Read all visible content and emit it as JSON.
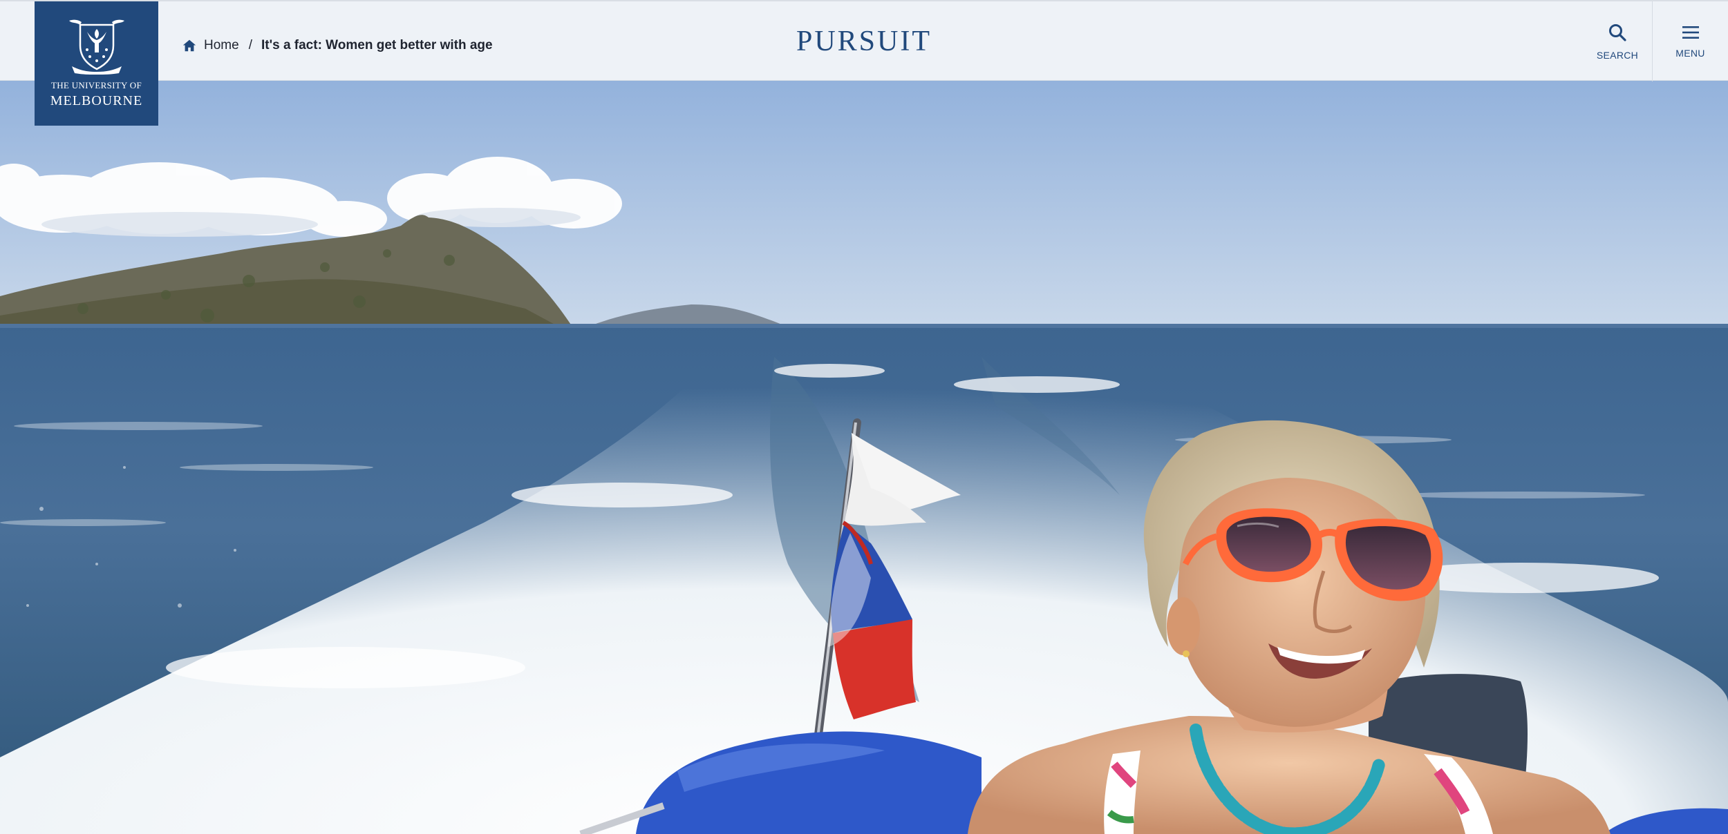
{
  "header": {
    "logo": {
      "line1": "THE UNIVERSITY OF",
      "line2": "MELBOURNE",
      "icon": "university-crest-icon"
    },
    "breadcrumb": {
      "home_label": "Home",
      "separator": "/",
      "current": "It's a fact: Women get better with age",
      "home_icon": "home-icon"
    },
    "site_title": "PURSUIT",
    "search": {
      "label": "SEARCH",
      "icon": "search-icon"
    },
    "menu": {
      "label": "MENU",
      "icon": "hamburger-menu-icon"
    }
  },
  "hero": {
    "image_subject": "hero-photo"
  },
  "colors": {
    "brand_navy": "#21497c",
    "header_bg": "#eef2f7",
    "text_dark": "#1f2430"
  }
}
